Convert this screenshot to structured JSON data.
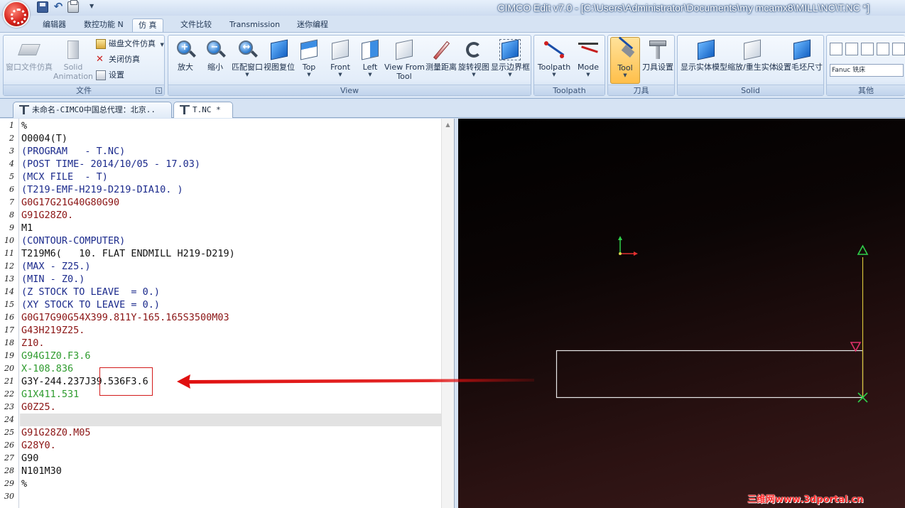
{
  "window": {
    "title": "CIMCO Edit v7.0 - [C:\\Users\\Administrator\\Documents\\my mcamx8\\MILL\\NC\\T.NC *]"
  },
  "quick_access": {
    "icons": [
      "save-icon",
      "undo-icon",
      "print-icon",
      "customize-icon"
    ]
  },
  "ribbon_tabs": [
    {
      "label": "编辑器",
      "active": false
    },
    {
      "label": "数控功能 N",
      "active": false
    },
    {
      "label": "仿 真",
      "active": true
    },
    {
      "label": "文件比较",
      "active": false
    },
    {
      "label": "Transmission",
      "active": false
    },
    {
      "label": "迷你编程",
      "active": false
    }
  ],
  "ribbon_groups": {
    "file": {
      "label": "文件",
      "buttons": [
        {
          "label": "窗口文件仿真",
          "icon": "window-sim-icon",
          "disabled": true
        },
        {
          "label": "Solid",
          "label2": "Animation",
          "icon": "solid-animation-icon",
          "disabled": true
        }
      ],
      "small_buttons": [
        {
          "label": "磁盘文件仿真",
          "icon": "disk-sim-icon"
        },
        {
          "label": "关闭仿真",
          "icon": "close-sim-icon"
        },
        {
          "label": "设置",
          "icon": "settings-icon"
        }
      ]
    },
    "view": {
      "label": "View",
      "buttons": [
        {
          "label": "放大",
          "icon": "zoom-in-icon"
        },
        {
          "label": "缩小",
          "icon": "zoom-out-icon"
        },
        {
          "label": "匹配窗口",
          "icon": "zoom-fit-icon"
        },
        {
          "label": "视图复位",
          "icon": "view-reset-icon"
        },
        {
          "label": "Top",
          "icon": "view-top-icon"
        },
        {
          "label": "Front",
          "icon": "view-front-icon"
        },
        {
          "label": "Left",
          "icon": "view-left-icon"
        },
        {
          "label": "View From",
          "label2": "Tool",
          "icon": "view-from-tool-icon"
        },
        {
          "label": "测量距离",
          "icon": "measure-icon"
        },
        {
          "label": "旋转视图",
          "icon": "rotate-view-icon"
        },
        {
          "label": "显示边界框",
          "icon": "bounding-box-icon"
        }
      ]
    },
    "toolpath": {
      "label": "Toolpath",
      "buttons": [
        {
          "label": "Toolpath",
          "icon": "toolpath-icon"
        },
        {
          "label": "Mode",
          "icon": "mode-icon"
        }
      ]
    },
    "tool": {
      "label": "刀具",
      "buttons": [
        {
          "label": "Tool",
          "icon": "tool-icon",
          "active": true
        },
        {
          "label": "刀具设置",
          "icon": "tool-settings-icon"
        }
      ]
    },
    "solid": {
      "label": "Solid",
      "buttons": [
        {
          "label": "显示实体模型",
          "icon": "show-solid-icon"
        },
        {
          "label": "缩放/重生实体",
          "icon": "regen-solid-icon"
        },
        {
          "label": "设置毛坯尺寸",
          "icon": "stock-size-icon"
        }
      ]
    },
    "other": {
      "label": "其他",
      "machine_select": "Fanuc 铣床"
    }
  },
  "doc_tabs": [
    {
      "label": "未命名-CIMCO中国总代理：北京..",
      "active": false
    },
    {
      "label": "T.NC *",
      "active": true
    }
  ],
  "colors": {
    "comment": "#1b2a8c",
    "rapid": "#8b1414",
    "feed": "#2e9b2e",
    "default": "#111111",
    "annotation": "#e01010"
  },
  "editor": {
    "lines": [
      {
        "n": "1",
        "text": "%",
        "color": "default"
      },
      {
        "n": "2",
        "text": "O0004(T)",
        "color": "default"
      },
      {
        "n": "3",
        "text": "(PROGRAM   - T.NC)",
        "color": "comment"
      },
      {
        "n": "4",
        "text": "(POST TIME- 2014/10/05 - 17.03)",
        "color": "comment"
      },
      {
        "n": "5",
        "text": "(MCX FILE  - T)",
        "color": "comment"
      },
      {
        "n": "6",
        "text": "(T219-EMF-H219-D219-DIA10. )",
        "color": "comment"
      },
      {
        "n": "7",
        "text": "G0G17G21G40G80G90",
        "color": "rapid"
      },
      {
        "n": "8",
        "text": "G91G28Z0.",
        "color": "rapid"
      },
      {
        "n": "9",
        "text": "M1",
        "color": "default"
      },
      {
        "n": "10",
        "text": "(CONTOUR-COMPUTER)",
        "color": "comment"
      },
      {
        "n": "11",
        "text": "T219M6(   10. FLAT ENDMILL H219-D219)",
        "color": "default"
      },
      {
        "n": "12",
        "text": "(MAX - Z25.)",
        "color": "comment"
      },
      {
        "n": "13",
        "text": "(MIN - Z0.)",
        "color": "comment"
      },
      {
        "n": "14",
        "text": "(Z STOCK TO LEAVE  = 0.)",
        "color": "comment"
      },
      {
        "n": "15",
        "text": "(XY STOCK TO LEAVE = 0.)",
        "color": "comment"
      },
      {
        "n": "16",
        "text": "G0G17G90G54X399.811Y-165.165S3500M03",
        "color": "rapid"
      },
      {
        "n": "17",
        "text": "G43H219Z25.",
        "color": "rapid"
      },
      {
        "n": "18",
        "text": "Z10.",
        "color": "rapid"
      },
      {
        "n": "19",
        "text": "G94G1Z0.F3.6",
        "color": "feed"
      },
      {
        "n": "20",
        "text": "X-108.836",
        "color": "feed"
      },
      {
        "n": "21",
        "text": "G3Y-244.237J39.536F3.6",
        "color": "default"
      },
      {
        "n": "22",
        "text": "G1X411.531",
        "color": "feed"
      },
      {
        "n": "23",
        "text": "G0Z25.",
        "color": "rapid"
      },
      {
        "n": "24",
        "text": "",
        "color": "default"
      },
      {
        "n": "25",
        "text": "G91G28Z0.M05",
        "color": "rapid"
      },
      {
        "n": "26",
        "text": "G28Y0.",
        "color": "rapid"
      },
      {
        "n": "27",
        "text": "G90",
        "color": "default"
      },
      {
        "n": "28",
        "text": "N101M30",
        "color": "default"
      },
      {
        "n": "29",
        "text": "%",
        "color": "default"
      },
      {
        "n": "30",
        "text": "",
        "color": "default"
      }
    ],
    "current_line": 24,
    "highlighted_token": "J39.536"
  },
  "viewport": {
    "background_top": "#000000",
    "background_bottom": "#3a1a1a",
    "stock_outline_color": "#e8e8e8",
    "toolpath_color": "#d6c23a",
    "tool_marker_color": "#2fcf4a",
    "end_marker_color": "#e0306a"
  },
  "watermark": "三维网www.3dportal.cn"
}
